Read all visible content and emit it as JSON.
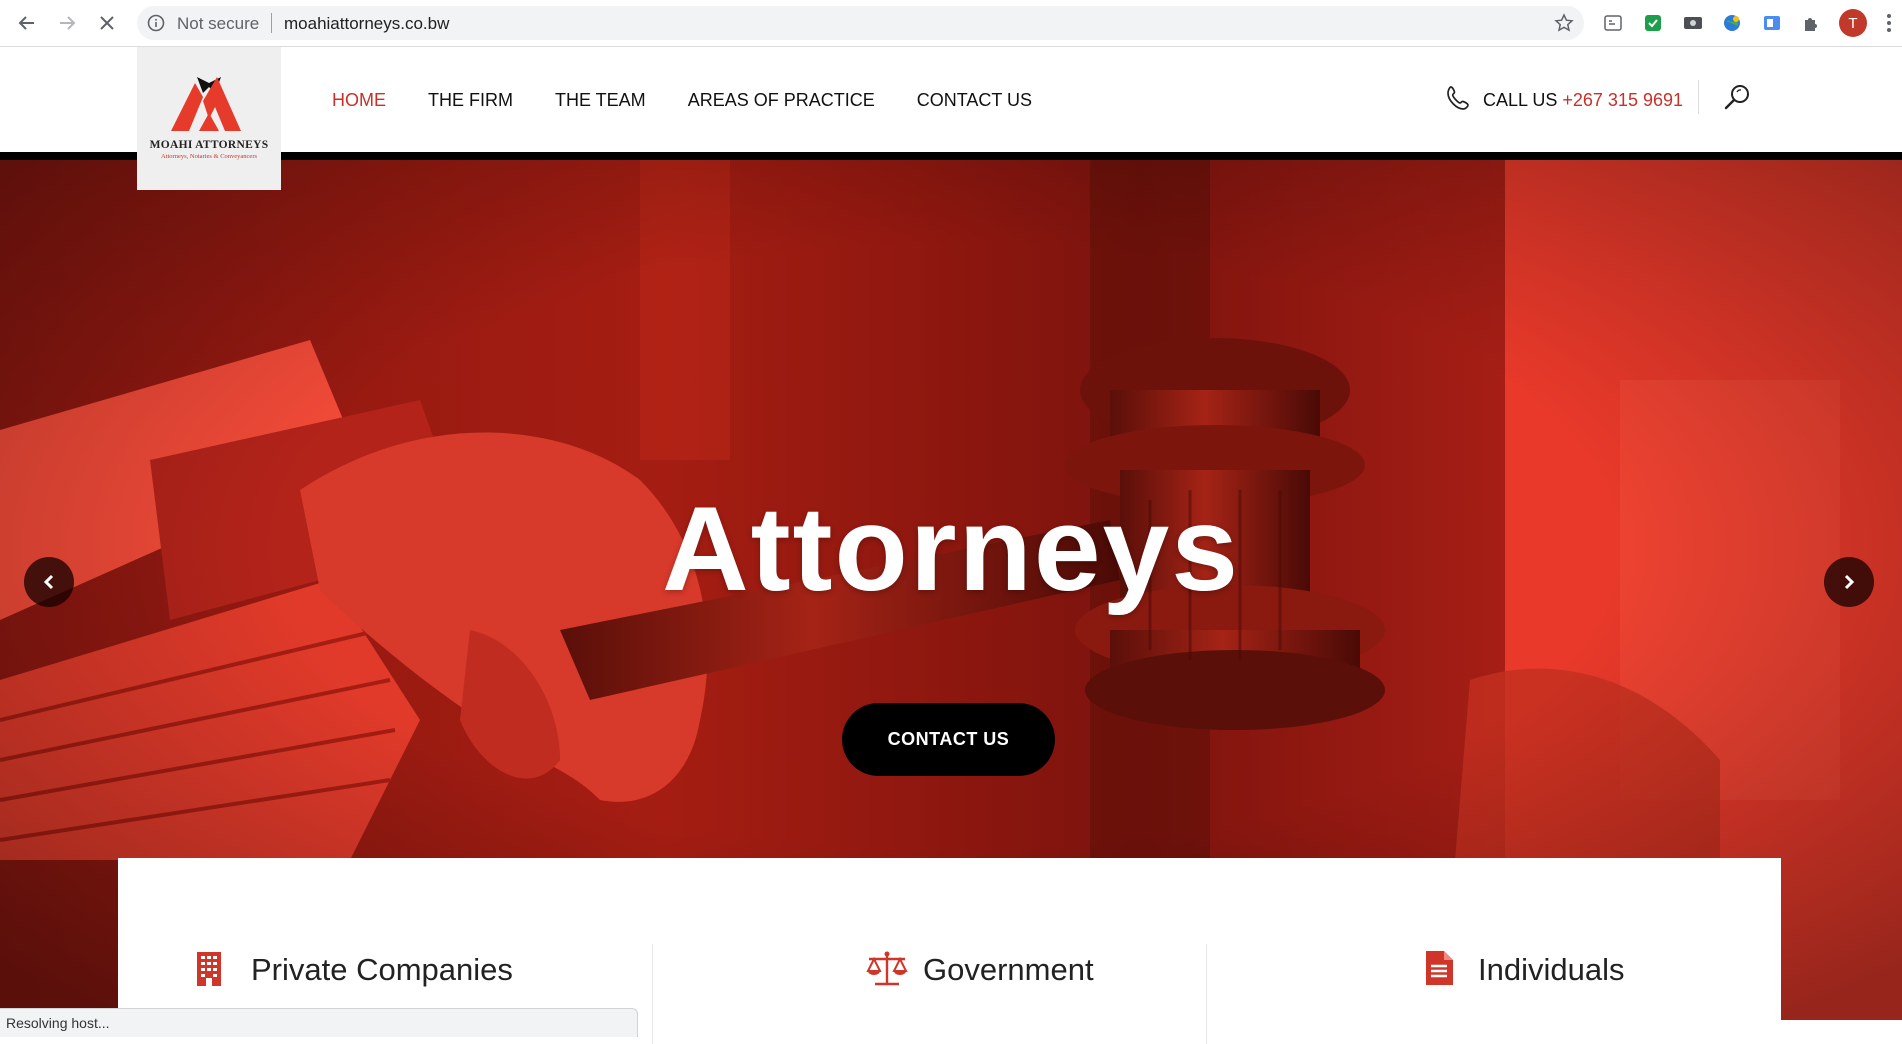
{
  "browser": {
    "security_label": "Not secure",
    "url": "moahiattorneys.co.bw",
    "profile_initial": "T",
    "status_text": "Resolving host..."
  },
  "site": {
    "logo": {
      "name": "MOAHI ATTORNEYS",
      "tagline": "Attorneys, Notaries & Conveyancers"
    },
    "nav": [
      {
        "label": "HOME",
        "active": true
      },
      {
        "label": "THE FIRM",
        "active": false
      },
      {
        "label": "THE TEAM",
        "active": false
      },
      {
        "label": "AREAS OF PRACTICE",
        "active": false
      },
      {
        "label": "CONTACT US",
        "active": false
      }
    ],
    "call": {
      "label": "CALL US",
      "number": "+267 315 9691"
    }
  },
  "hero": {
    "title": "Attorneys",
    "cta_label": "CONTACT US"
  },
  "cards": [
    {
      "label": "Private Companies",
      "icon": "building-icon"
    },
    {
      "label": "Government",
      "icon": "scales-icon"
    },
    {
      "label": "Individuals",
      "icon": "document-icon"
    }
  ],
  "colors": {
    "accent": "#c8302a",
    "hero_red": "#d42a1e",
    "cta_bg": "#000000"
  }
}
